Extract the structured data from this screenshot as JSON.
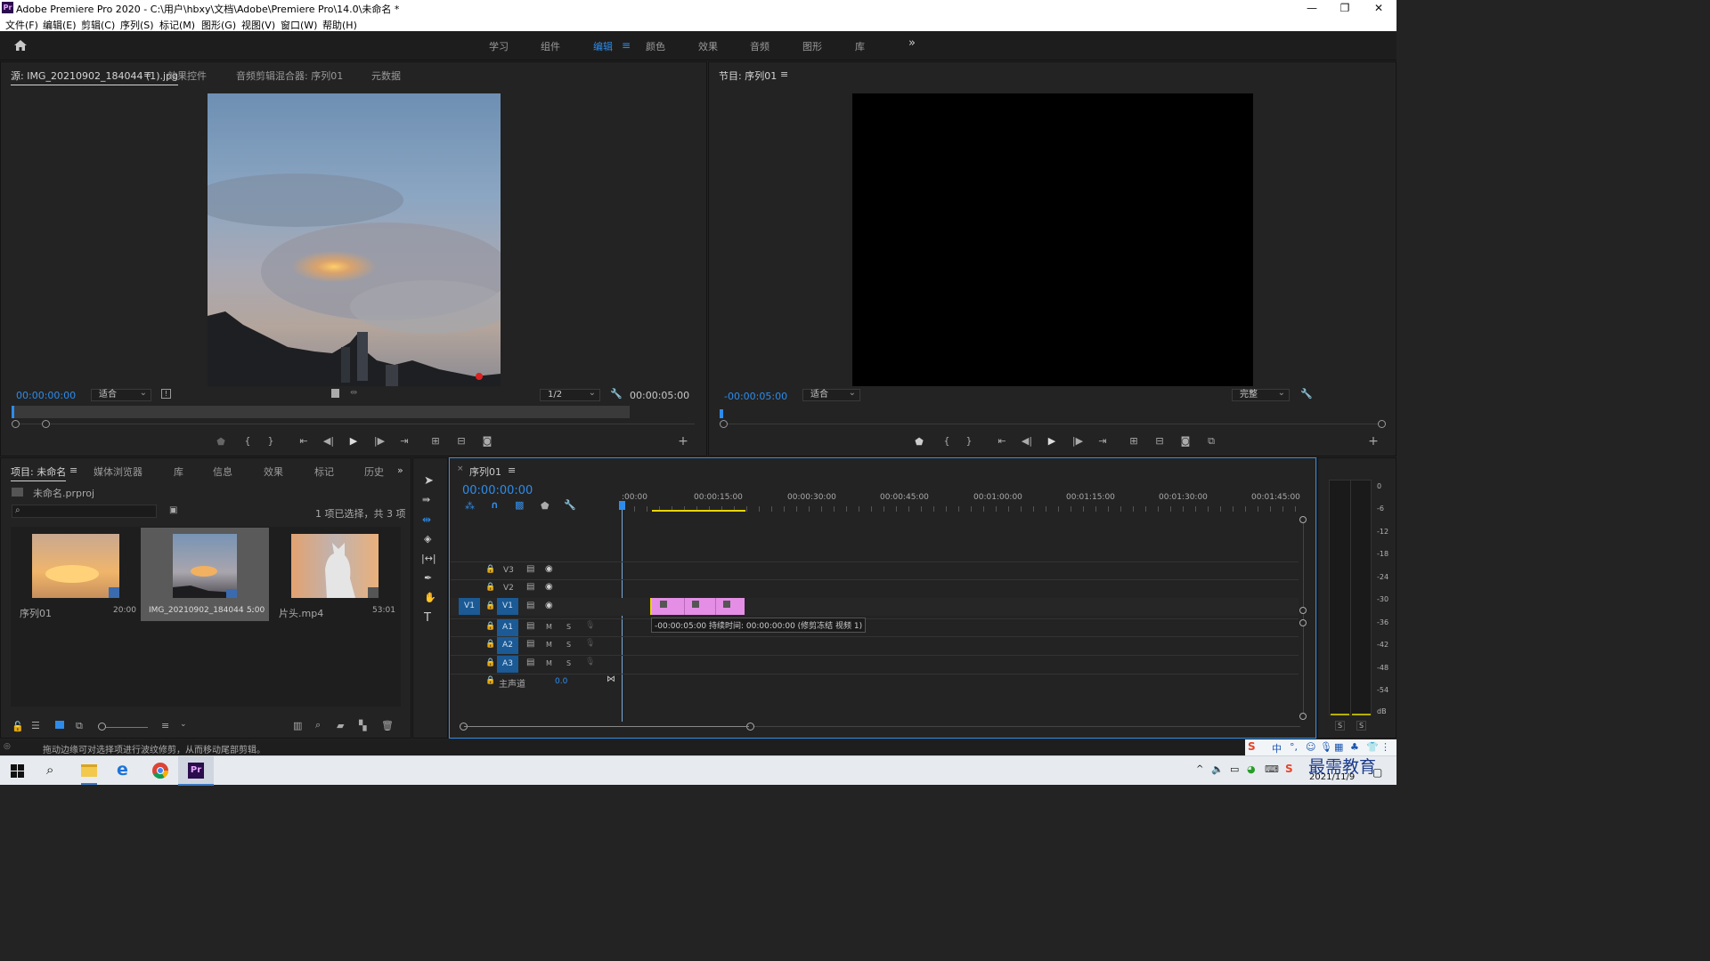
{
  "window": {
    "title": "Adobe Premiere Pro 2020 - C:\\用户\\hbxy\\文档\\Adobe\\Premiere Pro\\14.0\\未命名 *",
    "logo": "Pr",
    "minimize": "—",
    "restore": "❐",
    "close": "✕"
  },
  "menu": [
    "文件(F)",
    "编辑(E)",
    "剪辑(C)",
    "序列(S)",
    "标记(M)",
    "图形(G)",
    "视图(V)",
    "窗口(W)",
    "帮助(H)"
  ],
  "workspaces": {
    "items": [
      "学习",
      "组件",
      "编辑",
      "颜色",
      "效果",
      "音频",
      "图形",
      "库"
    ],
    "active": "编辑",
    "more": "»"
  },
  "source": {
    "tabs": [
      "源: IMG_20210902_184044 (1).jpg",
      "效果控件",
      "音频剪辑混合器: 序列01",
      "元数据"
    ],
    "timecode_in": "00:00:00:00",
    "fit": "适合",
    "resolution": "1/2",
    "timecode_out": "00:00:05:00"
  },
  "program": {
    "tab": "节目: 序列01",
    "timecode": "-00:00:05:00",
    "fit": "适合",
    "quality": "完整"
  },
  "project": {
    "tabs": [
      "项目: 未命名",
      "媒体浏览器",
      "库",
      "信息",
      "效果",
      "标记",
      "历史"
    ],
    "file": "未命名.prproj",
    "selection_info": "1 项已选择，共 3 项",
    "items": [
      {
        "name": "序列01",
        "duration": "20:00"
      },
      {
        "name": "IMG_20210902_184044 ...",
        "duration": "5:00"
      },
      {
        "name": "片头.mp4",
        "duration": "53:01"
      }
    ]
  },
  "timeline": {
    "tab": "序列01",
    "timecode": "00:00:00:00",
    "ruler": [
      ":00:00",
      "00:00:15:00",
      "00:00:30:00",
      "00:00:45:00",
      "00:01:00:00",
      "00:01:15:00",
      "00:01:30:00",
      "00:01:45:00"
    ],
    "video_tracks": [
      "V3",
      "V2",
      "V1"
    ],
    "audio_tracks": [
      "A1",
      "A2",
      "A3"
    ],
    "source_v": "V1",
    "source_a": "A1",
    "master": "主声道",
    "master_value": "0.0",
    "tooltip": "-00:00:05:00 持续时间: 00:00:00:00 (修剪冻结 视频 1)",
    "mute": "M",
    "solo": "S"
  },
  "meter": {
    "scale": [
      "0",
      "-6",
      "-12",
      "-18",
      "-24",
      "-30",
      "-36",
      "-42",
      "-48",
      "-54",
      "dB"
    ],
    "solo_left": "S",
    "solo_right": "S"
  },
  "status": "拖动边缘可对选择项进行波纹修剪，从而移动尾部剪辑。",
  "taskbar": {
    "date": "2021/11/9",
    "ime": "中",
    "watermark": "最需教育"
  },
  "colors": {
    "accent": "#2d8ceb",
    "clip": "#e58ee6",
    "panel": "#232323",
    "yellow": "#e8d500"
  }
}
